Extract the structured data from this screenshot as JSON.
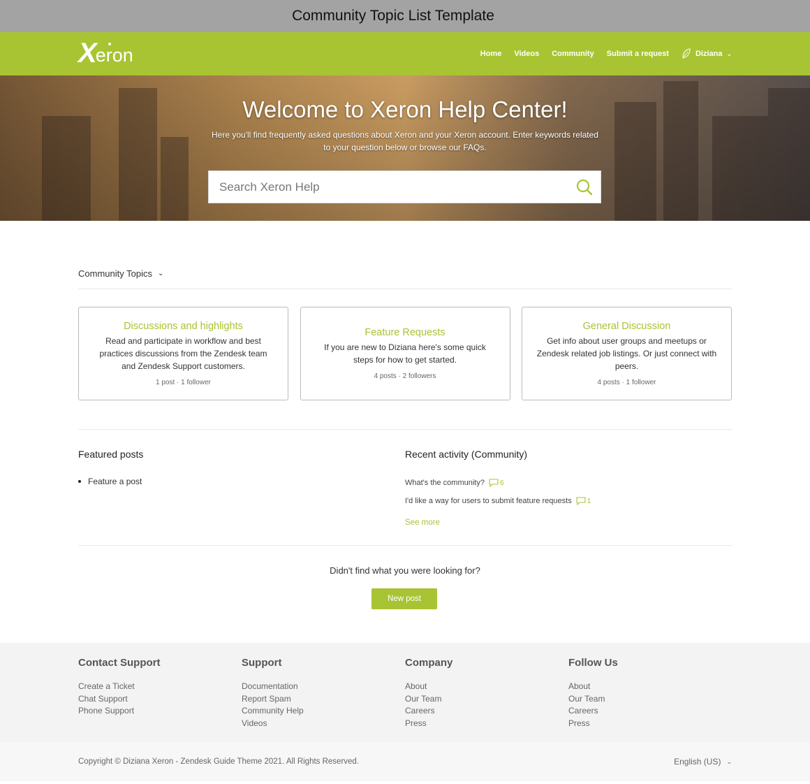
{
  "template_label": "Community Topic List Template",
  "brand": {
    "logo_x": "X",
    "logo_rest": "eron",
    "accent": "#a8c433"
  },
  "nav": {
    "links": [
      "Home",
      "Videos",
      "Community",
      "Submit a request"
    ],
    "user_name": "Diziana",
    "user_icon": "leaf-icon",
    "dropdown_icon": "chevron-down-icon"
  },
  "hero": {
    "title": "Welcome to Xeron Help Center!",
    "subtitle": "Here you'll find frequently asked questions about Xeron and your Xeron account. Enter keywords related to your question below or browse our FAQs.",
    "search_placeholder": "Search Xeron Help",
    "search_icon": "search-icon"
  },
  "topics": {
    "heading": "Community Topics",
    "cards": [
      {
        "title": "Discussions and highlights",
        "description": "Read and participate in workflow and best practices discussions from the Zendesk team and Zendesk Support customers.",
        "meta": "1 post ·   1 follower"
      },
      {
        "title": "Feature Requests",
        "description": "If you are new to Diziana here's some quick steps for how to get started.",
        "meta": "4 posts ·   2 followers"
      },
      {
        "title": "General Discussion",
        "description": "Get info about user groups and meetups or Zendesk related job listings. Or just connect with peers.",
        "meta": "4 posts ·   1 follower"
      }
    ]
  },
  "featured": {
    "title": "Featured posts",
    "items": [
      "Feature a post"
    ]
  },
  "recent": {
    "title": "Recent activity (Community)",
    "items": [
      {
        "text": "What's the community?",
        "count": "6"
      },
      {
        "text": "I'd like a way for users to submit feature requests",
        "count": "1"
      }
    ],
    "see_more": "See more",
    "comment_icon": "comment-icon"
  },
  "cta": {
    "text": "Didn't find what you were looking for?",
    "button": "New post"
  },
  "footer": {
    "columns": [
      {
        "title": "Contact Support",
        "links": [
          "Create a Ticket",
          "Chat Support",
          "Phone Support"
        ]
      },
      {
        "title": "Support",
        "links": [
          "Documentation",
          "Report Spam",
          "Community Help",
          "Videos"
        ]
      },
      {
        "title": "Company",
        "links": [
          "About",
          "Our Team",
          "Careers",
          "Press"
        ]
      },
      {
        "title": "Follow Us",
        "links": [
          "About",
          "Our Team",
          "Careers",
          "Press"
        ]
      }
    ],
    "copyright": "Copyright © Diziana Xeron - Zendesk Guide Theme 2021. All Rights Reserved.",
    "language": "English (US)"
  }
}
